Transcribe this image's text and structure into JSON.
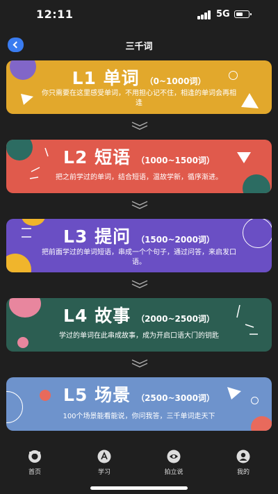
{
  "status_bar": {
    "time": "12:11",
    "network": "5G"
  },
  "header": {
    "title": "三千词"
  },
  "cards": [
    {
      "level": "L1 单词",
      "range": "（0~1000词）",
      "desc": "你只需要在这里感受单词，不用担心记不住，相逢的单词会再相逢",
      "color": "#e2a82c"
    },
    {
      "level": "L2 短语",
      "range": "（1000~1500词）",
      "desc": "把之前学过的单词，结合短语，温故学新，循序渐进。",
      "color": "#e05a4c"
    },
    {
      "level": "L3 提问",
      "range": "（1500~2000词）",
      "desc": "把前面学过的单词短语，串成一个个句子，通过问答，来启发口语。",
      "color": "#6a4fc4"
    },
    {
      "level": "L4 故事",
      "range": "（2000~2500词）",
      "desc": "学过的单词在此串成故事，成为开启口语大门的钥匙",
      "color": "#2c5e52"
    },
    {
      "level": "L5 场景",
      "range": "（2500~3000词）",
      "desc": "100个场景能看能说，你问我答，三千单词走天下",
      "color": "#6e93cc"
    }
  ],
  "tabs": [
    {
      "label": "首页",
      "icon": "home-icon"
    },
    {
      "label": "学习",
      "icon": "study-icon"
    },
    {
      "label": "拍立说",
      "icon": "camera-icon"
    },
    {
      "label": "我的",
      "icon": "profile-icon"
    }
  ]
}
